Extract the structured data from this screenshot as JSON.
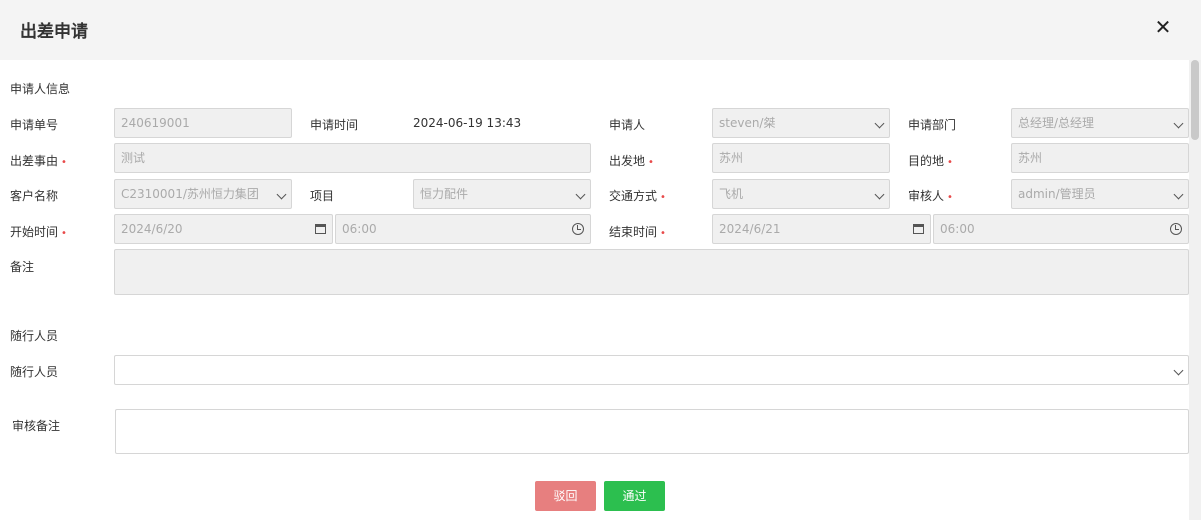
{
  "dialog": {
    "title": "出差申请",
    "close_symbol": "✕"
  },
  "applicant_section": {
    "title": "申请人信息"
  },
  "form": {
    "request_no": {
      "label": "申请单号",
      "value": "240619001"
    },
    "request_time": {
      "label": "申请时间",
      "value": "2024-06-19 13:43"
    },
    "applicant": {
      "label": "申请人",
      "value": "steven/桀"
    },
    "department": {
      "label": "申请部门",
      "value": "总经理/总经理"
    },
    "reason": {
      "label": "出差事由",
      "value": "测试",
      "required_mark": "•"
    },
    "departure": {
      "label": "出发地",
      "value": "苏州",
      "required_mark": "•"
    },
    "destination": {
      "label": "目的地",
      "value": "苏州",
      "required_mark": "•"
    },
    "customer": {
      "label": "客户名称",
      "value": "C2310001/苏州恒力集团"
    },
    "project": {
      "label": "项目",
      "value": "恒力配件"
    },
    "transport": {
      "label": "交通方式",
      "value": "飞机",
      "required_mark": "•"
    },
    "reviewer": {
      "label": "审核人",
      "value": "admin/管理员",
      "required_mark": "•"
    },
    "start": {
      "label": "开始时间",
      "date": "2024/6/20",
      "time": "06:00",
      "required_mark": "•"
    },
    "end": {
      "label": "结束时间",
      "date": "2024/6/21",
      "time": "06:00",
      "required_mark": "•"
    },
    "remarks": {
      "label": "备注",
      "value": ""
    }
  },
  "companion_section": {
    "title": "随行人员"
  },
  "companions": {
    "label": "随行人员",
    "value": ""
  },
  "review_note": {
    "label": "审核备注",
    "value": ""
  },
  "buttons": {
    "reject": "驳回",
    "approve": "通过"
  },
  "colors": {
    "reject": "#e77f7f",
    "approve": "#2cbf4f",
    "required": "#e84a4a",
    "field_bg": "#f0f0f0",
    "header_bg": "#f4f4f4"
  }
}
